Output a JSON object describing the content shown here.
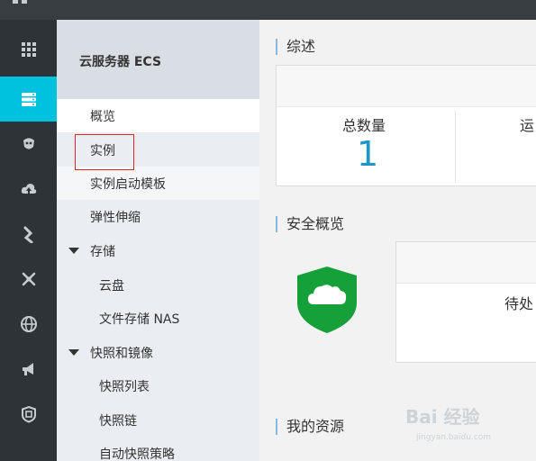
{
  "sidebar": {
    "title": "云服务器 ECS",
    "items": [
      {
        "label": "概览"
      },
      {
        "label": "实例"
      },
      {
        "label": "实例启动模板"
      },
      {
        "label": "弹性伸缩"
      },
      {
        "label": "存储"
      },
      {
        "label": "云盘"
      },
      {
        "label": "文件存储 NAS"
      },
      {
        "label": "快照和镜像"
      },
      {
        "label": "快照列表"
      },
      {
        "label": "快照链"
      },
      {
        "label": "自动快照策略"
      }
    ]
  },
  "rail_icons": [
    "grid-icon",
    "server-icon",
    "cloud-monitor-icon",
    "cloud-upload-icon",
    "link-icon",
    "network-icon",
    "globe-icon",
    "megaphone-icon",
    "shield-icon"
  ],
  "main": {
    "overview": {
      "title": "综述",
      "total_label": "总数量",
      "total_value": "1",
      "running_label_partial": "运"
    },
    "security": {
      "title": "安全概览",
      "pending_label_partial": "待处"
    },
    "resources": {
      "title": "我的资源"
    }
  },
  "colors": {
    "accent": "#00c1de",
    "rail_bg": "#2d3337",
    "shield_green": "#16a03a",
    "value_blue": "#1d96c9",
    "highlight_red": "#e0262a"
  },
  "watermark": {
    "brand": "Bai 经验",
    "url": "jingyan.baidu.com"
  }
}
